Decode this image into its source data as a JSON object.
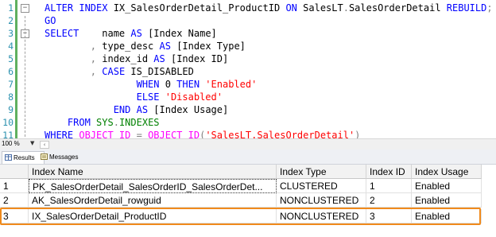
{
  "editor": {
    "line_numbers": [
      "1",
      "2",
      "3",
      "4",
      "5",
      "6",
      "7",
      "8",
      "9",
      "10",
      "11"
    ],
    "lines": [
      [
        {
          "t": "ALTER INDEX ",
          "c": "kw"
        },
        {
          "t": "IX_SalesOrderDetail_ProductID ",
          "c": ""
        },
        {
          "t": "ON ",
          "c": "kw"
        },
        {
          "t": "SalesLT",
          "c": ""
        },
        {
          "t": ".",
          "c": "op"
        },
        {
          "t": "SalesOrderDetail ",
          "c": ""
        },
        {
          "t": "REBUILD",
          "c": "kw"
        },
        {
          "t": ";",
          "c": "op"
        }
      ],
      [
        {
          "t": "GO",
          "c": "kw"
        }
      ],
      [
        {
          "t": "SELECT",
          "c": "kw"
        },
        {
          "t": "    name ",
          "c": ""
        },
        {
          "t": "AS ",
          "c": "kw"
        },
        {
          "t": "[Index Name]",
          "c": ""
        }
      ],
      [
        {
          "t": "        ",
          "c": ""
        },
        {
          "t": ",",
          "c": "op"
        },
        {
          "t": " type_desc ",
          "c": ""
        },
        {
          "t": "AS ",
          "c": "kw"
        },
        {
          "t": "[Index Type]",
          "c": ""
        }
      ],
      [
        {
          "t": "        ",
          "c": ""
        },
        {
          "t": ",",
          "c": "op"
        },
        {
          "t": " index_id ",
          "c": ""
        },
        {
          "t": "AS ",
          "c": "kw"
        },
        {
          "t": "[Index ID]",
          "c": ""
        }
      ],
      [
        {
          "t": "        ",
          "c": ""
        },
        {
          "t": ",",
          "c": "op"
        },
        {
          "t": " ",
          "c": ""
        },
        {
          "t": "CASE ",
          "c": "kw"
        },
        {
          "t": "IS_DISABLED",
          "c": ""
        }
      ],
      [
        {
          "t": "                ",
          "c": ""
        },
        {
          "t": "WHEN ",
          "c": "kw"
        },
        {
          "t": "0 ",
          "c": ""
        },
        {
          "t": "THEN ",
          "c": "kw"
        },
        {
          "t": "'Enabled'",
          "c": "str"
        }
      ],
      [
        {
          "t": "                ",
          "c": ""
        },
        {
          "t": "ELSE ",
          "c": "kw"
        },
        {
          "t": "'Disabled'",
          "c": "str"
        }
      ],
      [
        {
          "t": "            ",
          "c": ""
        },
        {
          "t": "END ",
          "c": "kw"
        },
        {
          "t": "AS ",
          "c": "kw"
        },
        {
          "t": "[Index Usage]",
          "c": ""
        }
      ],
      [
        {
          "t": "    ",
          "c": ""
        },
        {
          "t": "FROM ",
          "c": "kw"
        },
        {
          "t": "SYS",
          "c": "sys"
        },
        {
          "t": ".",
          "c": "op"
        },
        {
          "t": "INDEXES",
          "c": "sys"
        }
      ],
      [
        {
          "t": "WHERE ",
          "c": "kw"
        },
        {
          "t": "OBJECT_ID ",
          "c": "fn"
        },
        {
          "t": "= ",
          "c": "op"
        },
        {
          "t": "OBJECT_ID",
          "c": "fn"
        },
        {
          "t": "(",
          "c": "op"
        },
        {
          "t": "'SalesLT.SalesOrderDetail'",
          "c": "str"
        },
        {
          "t": ")",
          "c": "op"
        }
      ]
    ]
  },
  "zoom": {
    "value": "100 %"
  },
  "tabs": {
    "results": "Results",
    "messages": "Messages"
  },
  "grid": {
    "columns": [
      "Index Name",
      "Index Type",
      "Index ID",
      "Index Usage"
    ],
    "rows": [
      {
        "num": "1",
        "name": "PK_SalesOrderDetail_SalesOrderID_SalesOrderDet...",
        "type": "CLUSTERED",
        "id": "1",
        "usage": "Enabled"
      },
      {
        "num": "2",
        "name": "AK_SalesOrderDetail_rowguid",
        "type": "NONCLUSTERED",
        "id": "2",
        "usage": "Enabled"
      },
      {
        "num": "3",
        "name": "IX_SalesOrderDetail_ProductID",
        "type": "NONCLUSTERED",
        "id": "3",
        "usage": "Enabled"
      }
    ],
    "highlight_color": "#f08a1c"
  }
}
